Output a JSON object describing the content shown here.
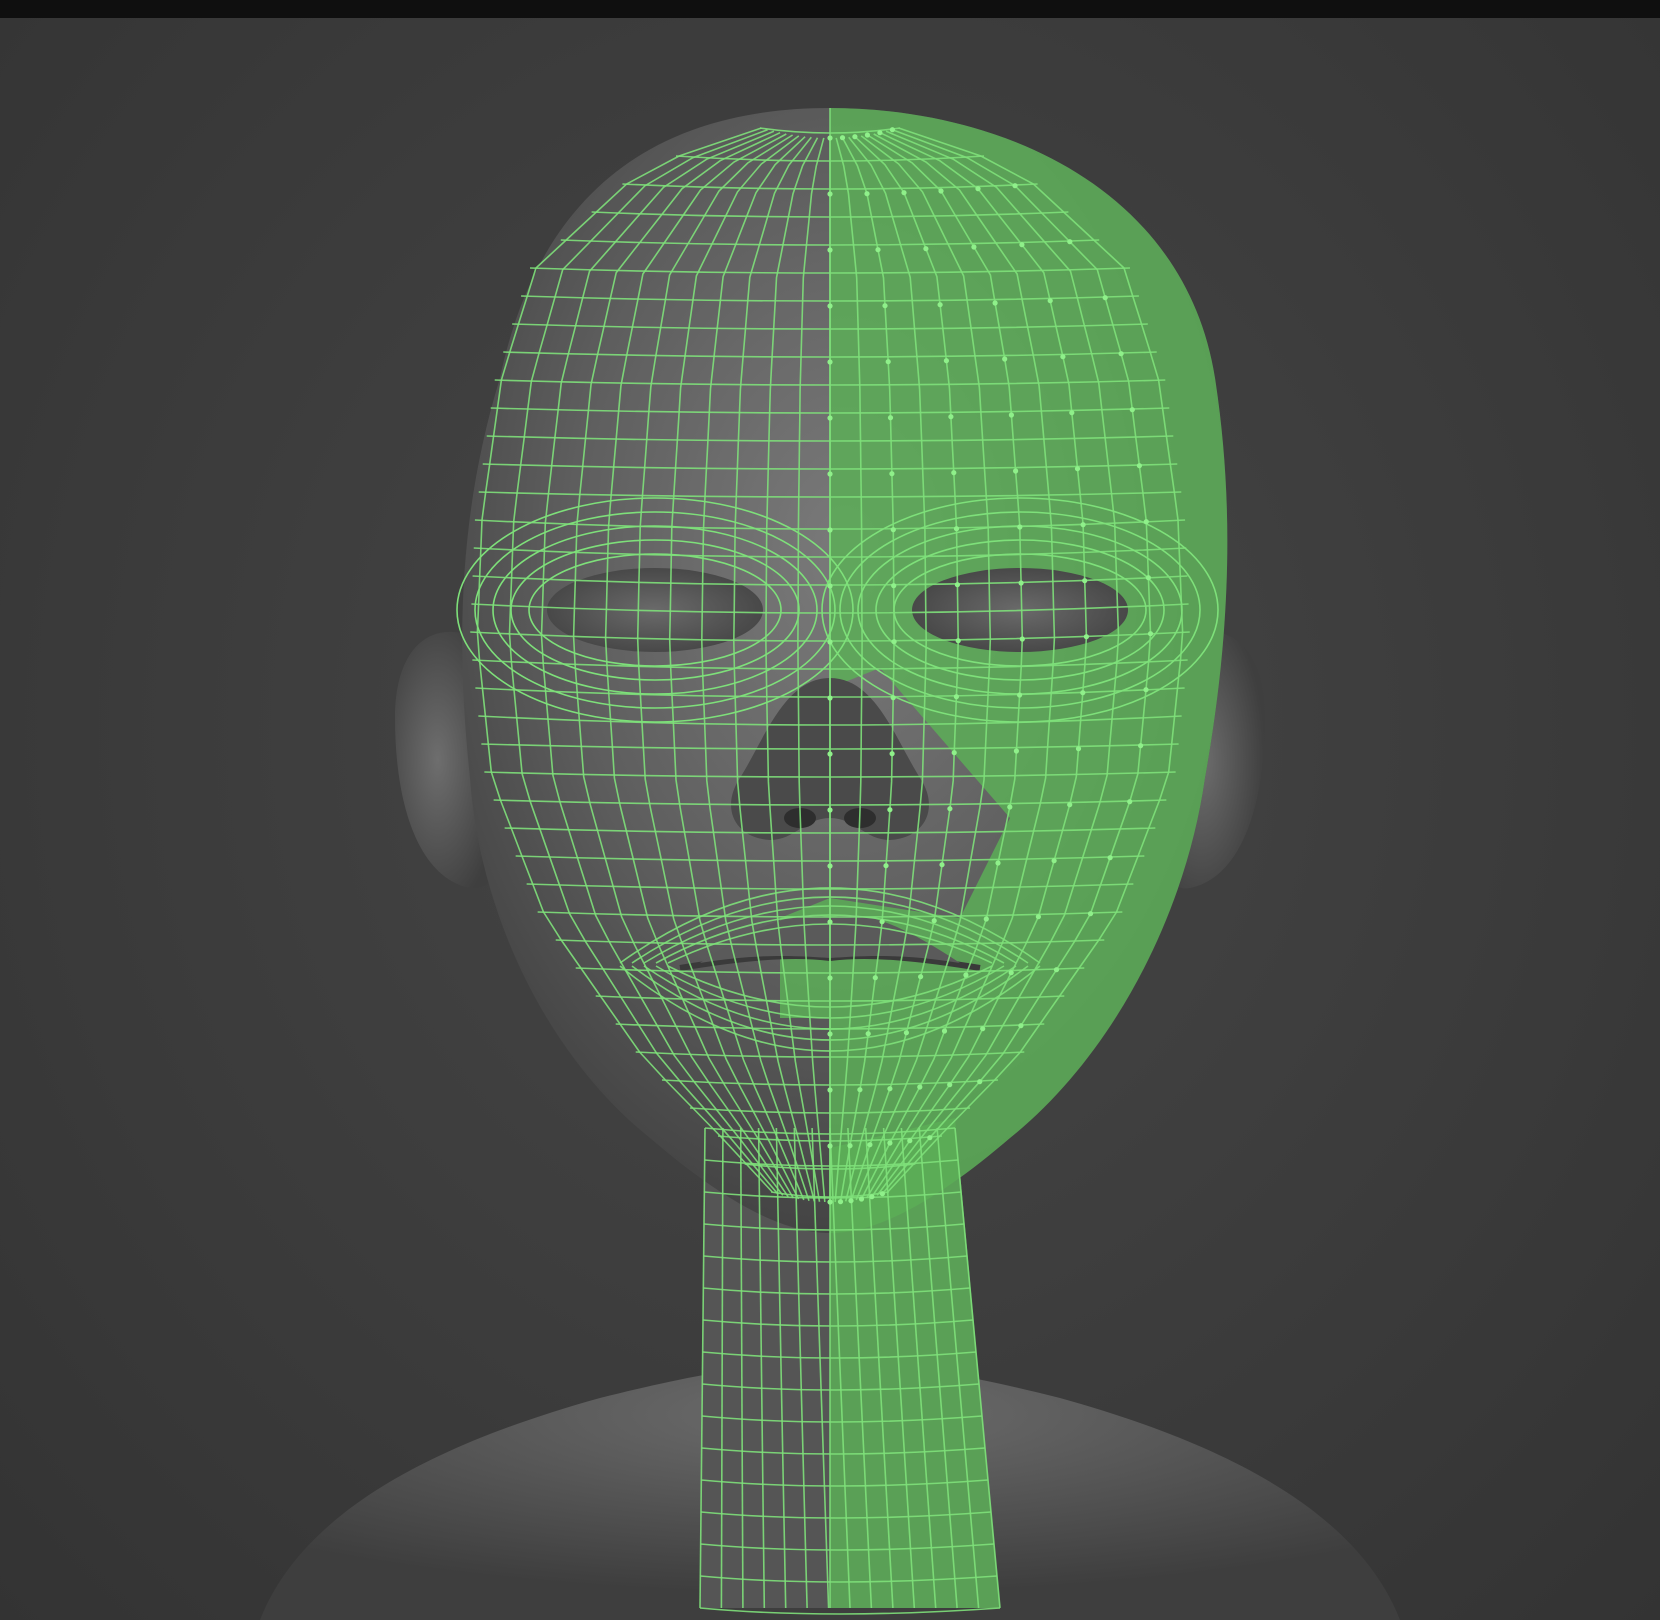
{
  "viewport": {
    "background_color": "#3c3c3c",
    "top_bar_color": "#0f0f0f"
  },
  "model": {
    "clay_color": "#6a6a6a",
    "wireframe_color": "#7ee07a",
    "selected_face_color": "#5cae57",
    "vertex_color": "#8ff08a"
  }
}
